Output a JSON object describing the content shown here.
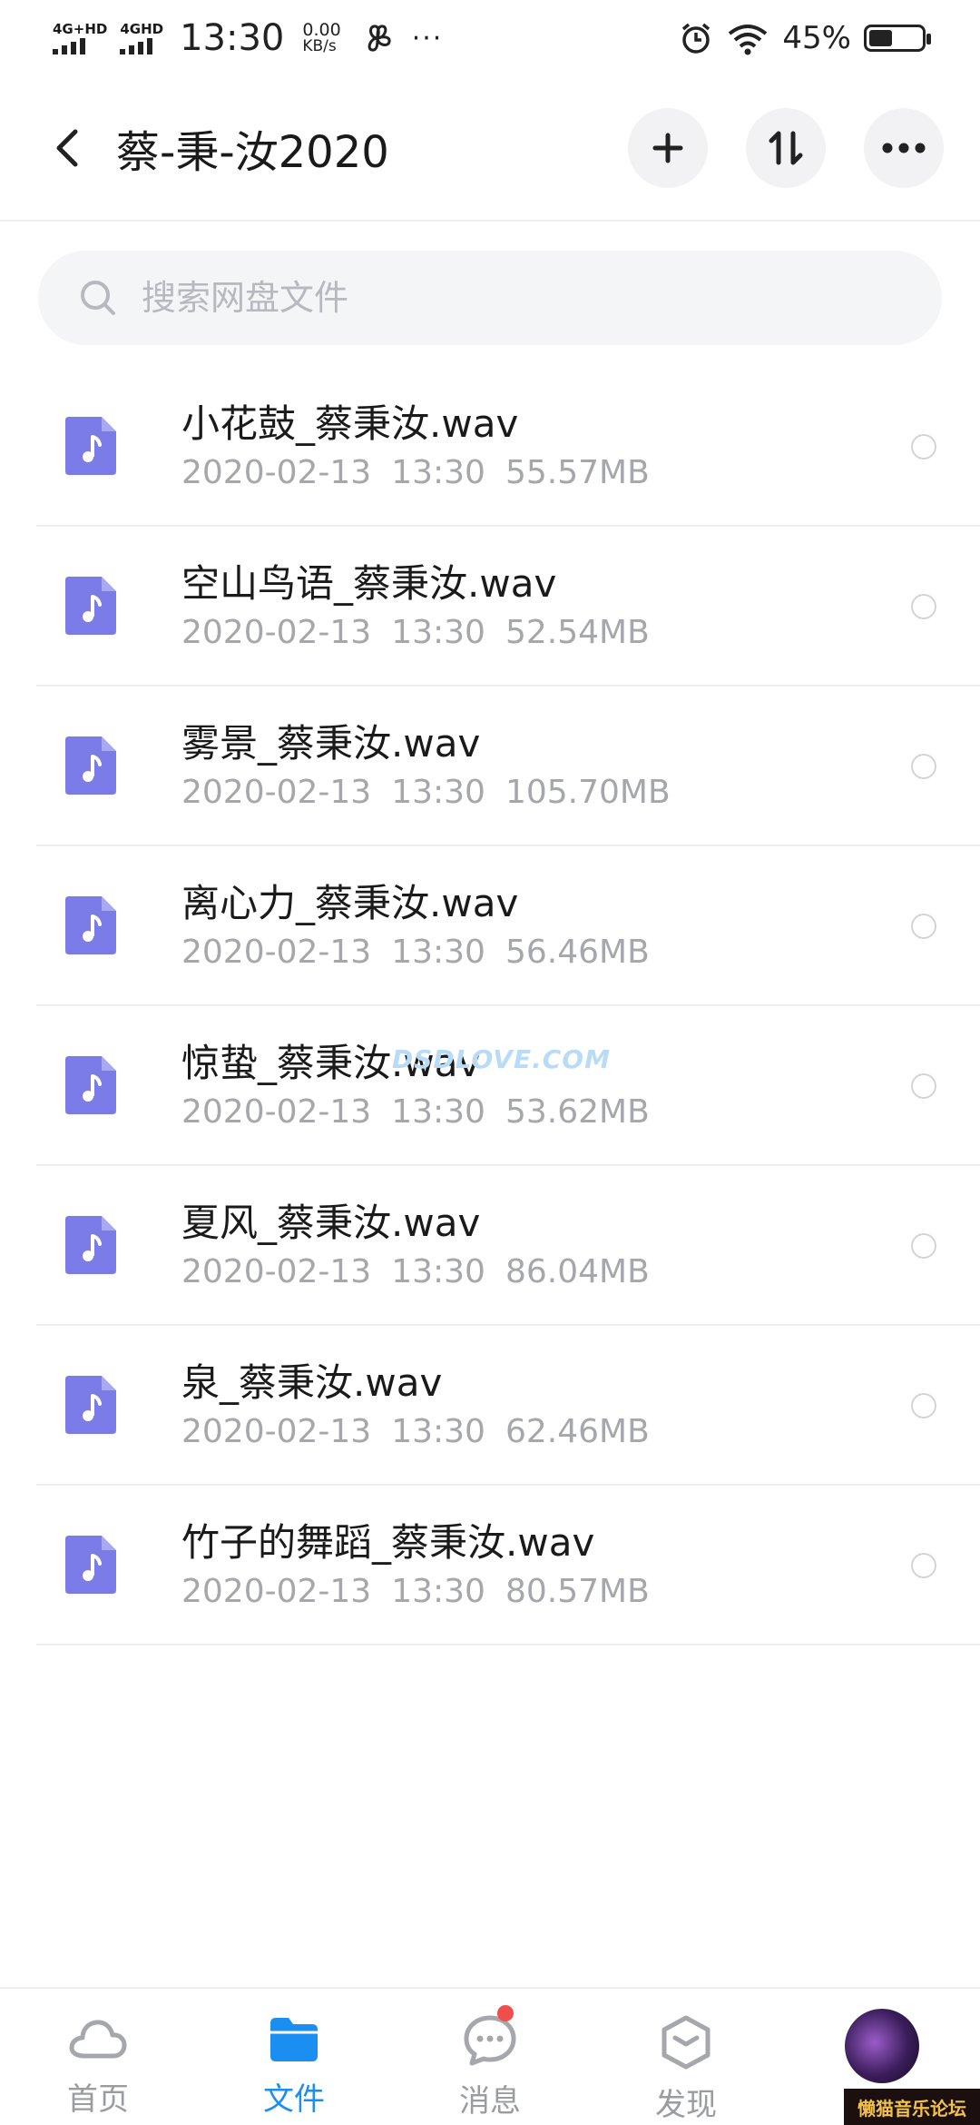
{
  "status_bar": {
    "net1": "4G+HD",
    "net2": "4GHD",
    "time": "13:30",
    "speed_value": "0.00",
    "speed_unit": "KB/s",
    "battery": "45%",
    "battery_level": 0.45
  },
  "header": {
    "title": "蔡-秉-汝2020",
    "add_label": "+",
    "sort_label": "⇅",
    "more_label": "•••"
  },
  "search": {
    "placeholder": "搜索网盘文件"
  },
  "files": [
    {
      "name": "小花鼓_蔡秉汝.wav",
      "date": "2020-02-13",
      "time": "13:30",
      "size": "55.57MB"
    },
    {
      "name": "空山鸟语_蔡秉汝.wav",
      "date": "2020-02-13",
      "time": "13:30",
      "size": "52.54MB"
    },
    {
      "name": "雾景_蔡秉汝.wav",
      "date": "2020-02-13",
      "time": "13:30",
      "size": "105.70MB"
    },
    {
      "name": "离心力_蔡秉汝.wav",
      "date": "2020-02-13",
      "time": "13:30",
      "size": "56.46MB"
    },
    {
      "name": "惊蛰_蔡秉汝.wav",
      "date": "2020-02-13",
      "time": "13:30",
      "size": "53.62MB"
    },
    {
      "name": "夏风_蔡秉汝.wav",
      "date": "2020-02-13",
      "time": "13:30",
      "size": "86.04MB"
    },
    {
      "name": "泉_蔡秉汝.wav",
      "date": "2020-02-13",
      "time": "13:30",
      "size": "62.46MB"
    },
    {
      "name": "竹子的舞蹈_蔡秉汝.wav",
      "date": "2020-02-13",
      "time": "13:30",
      "size": "80.57MB"
    }
  ],
  "watermark": "DSDLOVE.COM",
  "bottom_nav": {
    "home": "首页",
    "files": "文件",
    "messages": "消息",
    "discover": "发现",
    "forum_tag": "懒猫音乐论坛"
  },
  "colors": {
    "accent": "#1b8ff1",
    "file_icon": "#7c7ce8",
    "badge": "#f24d4d"
  },
  "icons": {
    "back": "chevron-left-icon",
    "search": "search-icon",
    "file": "audio-file-icon",
    "home": "cloud-icon",
    "files": "folder-icon",
    "messages": "chat-bubble-icon",
    "discover": "hexagon-icon"
  }
}
